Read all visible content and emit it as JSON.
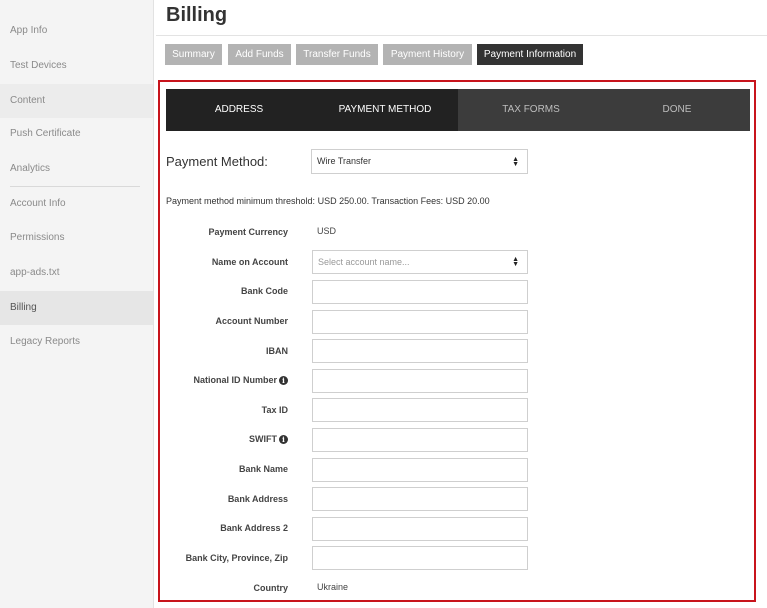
{
  "sidebar": {
    "items": [
      {
        "label": "App Info"
      },
      {
        "label": "Test Devices"
      },
      {
        "label": "Content"
      },
      {
        "label": "Push Certificate"
      },
      {
        "label": "Analytics"
      },
      {
        "label": "Account Info"
      },
      {
        "label": "Permissions"
      },
      {
        "label": "app-ads.txt"
      },
      {
        "label": "Billing"
      },
      {
        "label": "Legacy Reports"
      }
    ]
  },
  "header": {
    "title": "Billing"
  },
  "tabs": [
    {
      "label": "Summary"
    },
    {
      "label": "Add Funds"
    },
    {
      "label": "Transfer Funds"
    },
    {
      "label": "Payment History"
    },
    {
      "label": "Payment Information"
    }
  ],
  "stepper": {
    "steps": [
      {
        "label": "ADDRESS"
      },
      {
        "label": "PAYMENT METHOD"
      },
      {
        "label": "TAX FORMS"
      },
      {
        "label": "DONE"
      }
    ]
  },
  "payment": {
    "label": "Payment Method:",
    "selected": "Wire Transfer",
    "threshold_text": "Payment method minimum threshold: USD 250.00. Transaction Fees: USD 20.00"
  },
  "form": {
    "currency_label": "Payment Currency",
    "currency_value": "USD",
    "name_label": "Name on Account",
    "name_placeholder": "Select account name...",
    "bank_code_label": "Bank Code",
    "account_number_label": "Account Number",
    "iban_label": "IBAN",
    "national_id_label": "National ID Number",
    "tax_id_label": "Tax ID",
    "swift_label": "SWIFT",
    "bank_name_label": "Bank Name",
    "bank_address_label": "Bank Address",
    "bank_address2_label": "Bank Address 2",
    "bank_city_label": "Bank City, Province, Zip",
    "country_label": "Country",
    "country_value": "Ukraine"
  },
  "icons": {
    "info": "info-icon",
    "select_arrow": "sort-arrows-icon"
  },
  "colors": {
    "frame": "#c8141c",
    "active_tab": "#333333",
    "tab": "#b3b3b3"
  }
}
